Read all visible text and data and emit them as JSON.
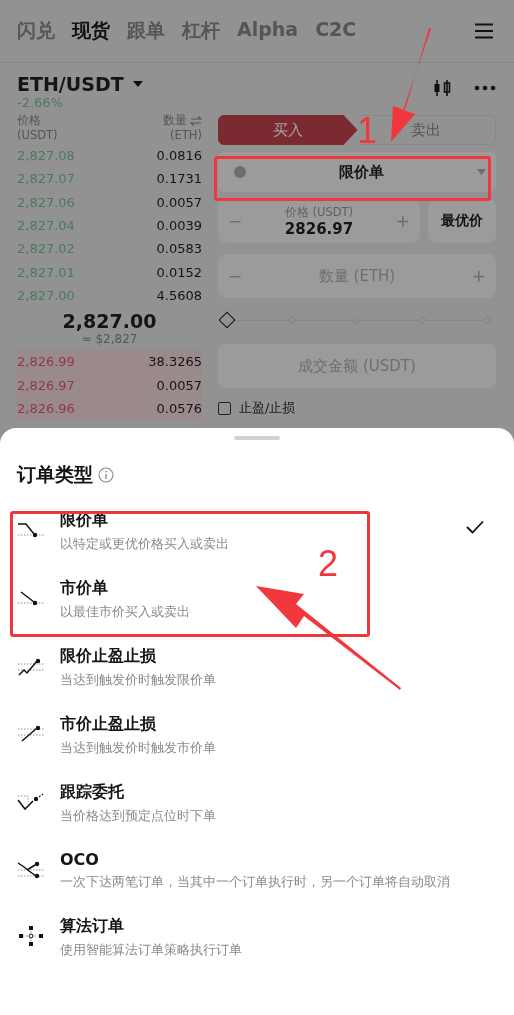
{
  "nav_tabs": [
    {
      "label": "闪兑",
      "selected": false
    },
    {
      "label": "现货",
      "selected": true
    },
    {
      "label": "跟单",
      "selected": false
    },
    {
      "label": "杠杆",
      "selected": false
    },
    {
      "label": "Alpha",
      "selected": false
    },
    {
      "label": "C2C",
      "selected": false
    }
  ],
  "pair": {
    "symbol": "ETH/USDT",
    "change": "-2.66%"
  },
  "order_book": {
    "price_header": "价格",
    "price_unit": "(USDT)",
    "amount_header": "数量",
    "amount_unit": "(ETH)",
    "asks": [
      {
        "price": "2,827.08",
        "amount": "0.0816"
      },
      {
        "price": "2,827.07",
        "amount": "0.1731"
      },
      {
        "price": "2,827.06",
        "amount": "0.0057"
      },
      {
        "price": "2,827.04",
        "amount": "0.0039"
      },
      {
        "price": "2,827.02",
        "amount": "0.0583"
      },
      {
        "price": "2,827.01",
        "amount": "0.0152"
      },
      {
        "price": "2,827.00",
        "amount": "4.5608"
      }
    ],
    "last_price": "2,827.00",
    "last_price_usd": "≈ $2,827",
    "bids": [
      {
        "price": "2,826.99",
        "amount": "38.3265"
      },
      {
        "price": "2,826.97",
        "amount": "0.0057"
      },
      {
        "price": "2,826.96",
        "amount": "0.0576"
      }
    ]
  },
  "trade_form": {
    "sides": [
      {
        "label": "买入",
        "selected": true
      },
      {
        "label": "卖出",
        "selected": false
      }
    ],
    "order_type": "限价单",
    "price_field": {
      "label": "价格 (USDT)",
      "value": "2826.97",
      "decrement": "−",
      "increment": "+"
    },
    "best_price_button": "最优价",
    "quantity_field": {
      "placeholder": "数量 (ETH)",
      "decrement": "−",
      "increment": "+"
    },
    "slider": {
      "level": 0
    },
    "amount_field": {
      "placeholder": "成交金额 (USDT)"
    },
    "tp_sl": {
      "label": "止盈/止损",
      "checked": false
    }
  },
  "order_type_sheet": {
    "title": "订单类型",
    "options": [
      {
        "kind": "limit",
        "title": "限价单",
        "description": "以特定或更优价格买入或卖出",
        "selected": true
      },
      {
        "kind": "market",
        "title": "市价单",
        "description": "以最佳市价买入或卖出",
        "selected": false
      },
      {
        "kind": "limit_tpsl",
        "title": "限价止盈止损",
        "description": "当达到触发价时触发限价单",
        "selected": false
      },
      {
        "kind": "market_tpsl",
        "title": "市价止盈止损",
        "description": "当达到触发价时触发市价单",
        "selected": false
      },
      {
        "kind": "trailing",
        "title": "跟踪委托",
        "description": "当价格达到预定点位时下单",
        "selected": false
      },
      {
        "kind": "oco",
        "title": "OCO",
        "description": "一次下达两笔订单，当其中一个订单执行时，另一个订单将自动取消",
        "selected": false
      },
      {
        "kind": "algo",
        "title": "算法订单",
        "description": "使用智能算法订单策略执行订单",
        "selected": false
      }
    ]
  },
  "annotations": [
    {
      "label": "1"
    },
    {
      "label": "2"
    }
  ]
}
